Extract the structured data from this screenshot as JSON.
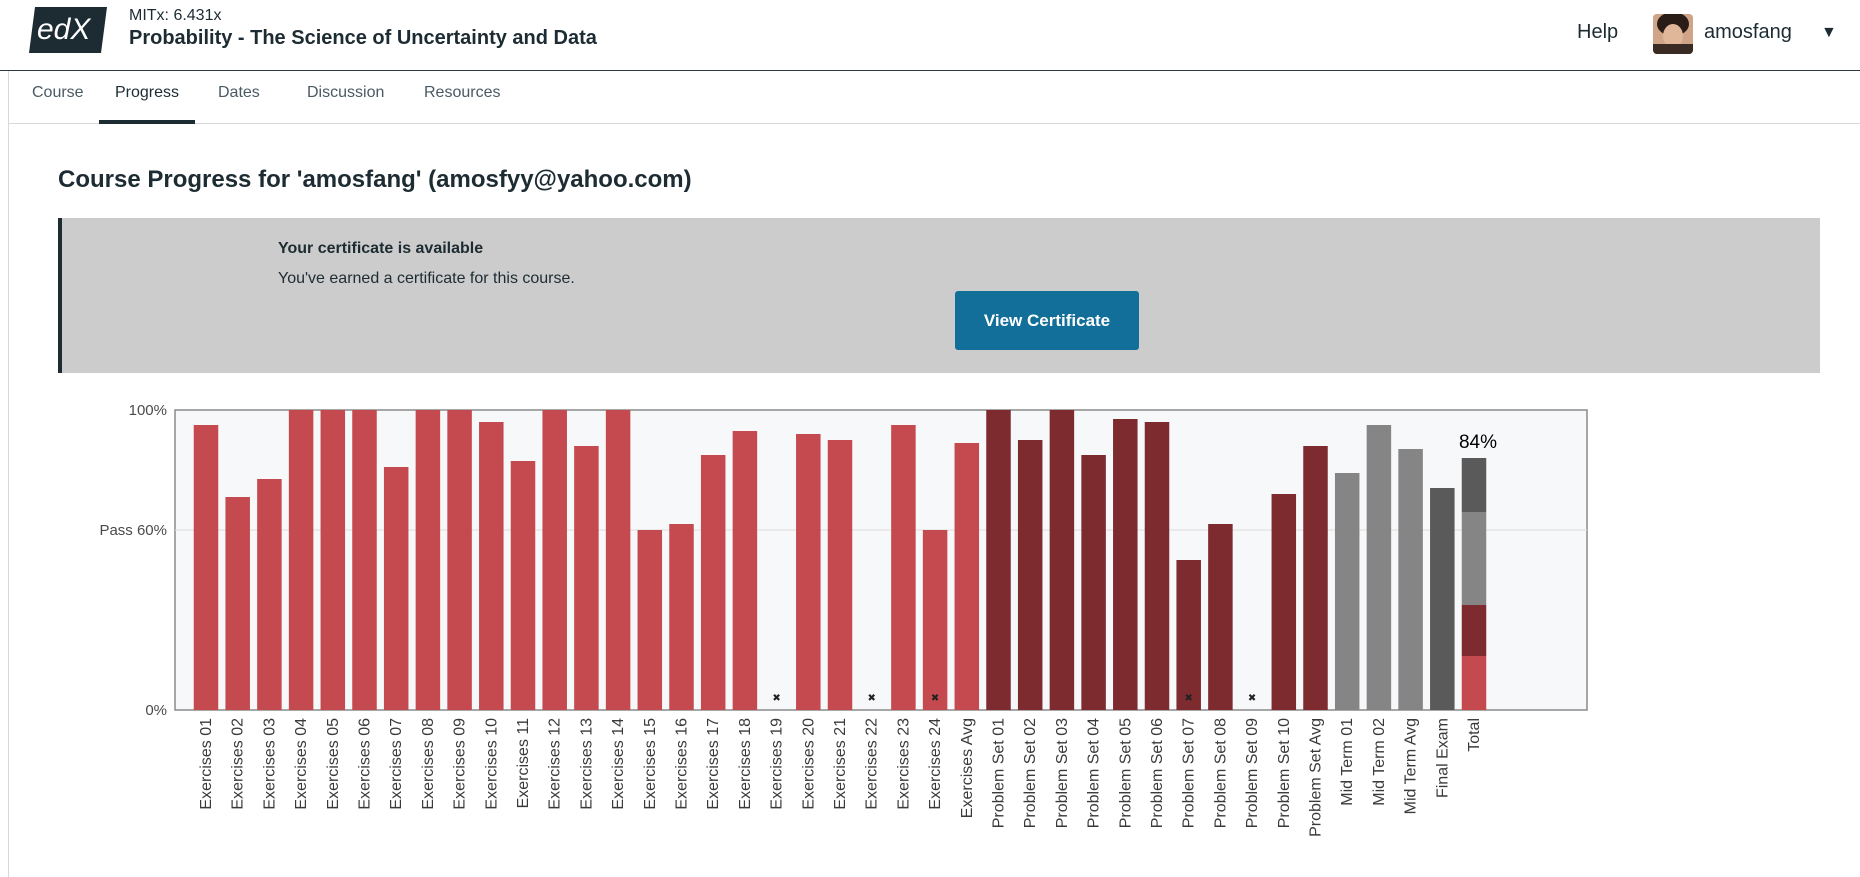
{
  "header": {
    "logo_text": "edX",
    "course_org": "MITx: 6.431x",
    "course_title": "Probability - The Science of Uncertainty and Data",
    "help_label": "Help",
    "username": "amosfang",
    "caret": "▼"
  },
  "tabs": [
    {
      "label": "Course"
    },
    {
      "label": "Progress"
    },
    {
      "label": "Dates"
    },
    {
      "label": "Discussion"
    },
    {
      "label": "Resources"
    }
  ],
  "page": {
    "title": "Course Progress for 'amosfang' (amosfyy@yahoo.com)"
  },
  "certificate": {
    "title": "Your certificate is available",
    "text": "You've earned a certificate for this course.",
    "button_label": "View Certificate"
  },
  "colors": {
    "exercises": "#c44a4f",
    "problem_sets": "#7e2b30",
    "mid_terms": "#858585",
    "final_exam": "#5a5a5a",
    "chart_bg": "#f7f8fa",
    "accent_button": "#126f9a"
  },
  "chart_data": {
    "type": "bar",
    "y_ticks": [
      {
        "label": "100%",
        "value": 100
      },
      {
        "label": "Pass 60%",
        "value": 60
      },
      {
        "label": "0%",
        "value": 0
      }
    ],
    "ylim": [
      0,
      100
    ],
    "pass_line": 60,
    "total_label": "84%",
    "missing_marker": "✖",
    "bars": [
      {
        "label": "Exercises 01",
        "value": 95,
        "group": "exercises"
      },
      {
        "label": "Exercises 02",
        "value": 71,
        "group": "exercises"
      },
      {
        "label": "Exercises 03",
        "value": 77,
        "group": "exercises"
      },
      {
        "label": "Exercises 04",
        "value": 100,
        "group": "exercises"
      },
      {
        "label": "Exercises 05",
        "value": 100,
        "group": "exercises"
      },
      {
        "label": "Exercises 06",
        "value": 100,
        "group": "exercises"
      },
      {
        "label": "Exercises 07",
        "value": 81,
        "group": "exercises"
      },
      {
        "label": "Exercises 08",
        "value": 100,
        "group": "exercises"
      },
      {
        "label": "Exercises 09",
        "value": 100,
        "group": "exercises"
      },
      {
        "label": "Exercises 10",
        "value": 96,
        "group": "exercises"
      },
      {
        "label": "Exercises 11",
        "value": 83,
        "group": "exercises"
      },
      {
        "label": "Exercises 12",
        "value": 100,
        "group": "exercises"
      },
      {
        "label": "Exercises 13",
        "value": 88,
        "group": "exercises"
      },
      {
        "label": "Exercises 14",
        "value": 100,
        "group": "exercises"
      },
      {
        "label": "Exercises 15",
        "value": 60,
        "group": "exercises"
      },
      {
        "label": "Exercises 16",
        "value": 62,
        "group": "exercises"
      },
      {
        "label": "Exercises 17",
        "value": 85,
        "group": "exercises"
      },
      {
        "label": "Exercises 18",
        "value": 93,
        "group": "exercises"
      },
      {
        "label": "Exercises 19",
        "value": 0,
        "group": "exercises",
        "missing": true
      },
      {
        "label": "Exercises 20",
        "value": 92,
        "group": "exercises"
      },
      {
        "label": "Exercises 21",
        "value": 90,
        "group": "exercises"
      },
      {
        "label": "Exercises 22",
        "value": 0,
        "group": "exercises",
        "missing": true
      },
      {
        "label": "Exercises 23",
        "value": 95,
        "group": "exercises"
      },
      {
        "label": "Exercises 24",
        "value": 60,
        "group": "exercises",
        "missing": true
      },
      {
        "label": "Exercises Avg",
        "value": 89,
        "group": "exercises"
      },
      {
        "label": "Problem Set 01",
        "value": 100,
        "group": "problem_sets"
      },
      {
        "label": "Problem Set 02",
        "value": 90,
        "group": "problem_sets"
      },
      {
        "label": "Problem Set 03",
        "value": 100,
        "group": "problem_sets"
      },
      {
        "label": "Problem Set 04",
        "value": 85,
        "group": "problem_sets"
      },
      {
        "label": "Problem Set 05",
        "value": 97,
        "group": "problem_sets"
      },
      {
        "label": "Problem Set 06",
        "value": 96,
        "group": "problem_sets"
      },
      {
        "label": "Problem Set 07",
        "value": 50,
        "group": "problem_sets",
        "missing": true
      },
      {
        "label": "Problem Set 08",
        "value": 62,
        "group": "problem_sets"
      },
      {
        "label": "Problem Set 09",
        "value": 0,
        "group": "problem_sets",
        "missing": true
      },
      {
        "label": "Problem Set 10",
        "value": 72,
        "group": "problem_sets"
      },
      {
        "label": "Problem Set Avg",
        "value": 88,
        "group": "problem_sets"
      },
      {
        "label": "Mid Term 01",
        "value": 79,
        "group": "mid_terms"
      },
      {
        "label": "Mid Term 02",
        "value": 95,
        "group": "mid_terms"
      },
      {
        "label": "Mid Term Avg",
        "value": 87,
        "group": "mid_terms"
      },
      {
        "label": "Final Exam",
        "value": 74,
        "group": "final_exam"
      },
      {
        "label": "Total",
        "value": 84,
        "group": "total"
      }
    ],
    "total_segments": [
      {
        "group": "exercises",
        "value": 18
      },
      {
        "group": "problem_sets",
        "value": 17
      },
      {
        "group": "mid_terms",
        "value": 31
      },
      {
        "group": "final_exam",
        "value": 18
      }
    ]
  }
}
